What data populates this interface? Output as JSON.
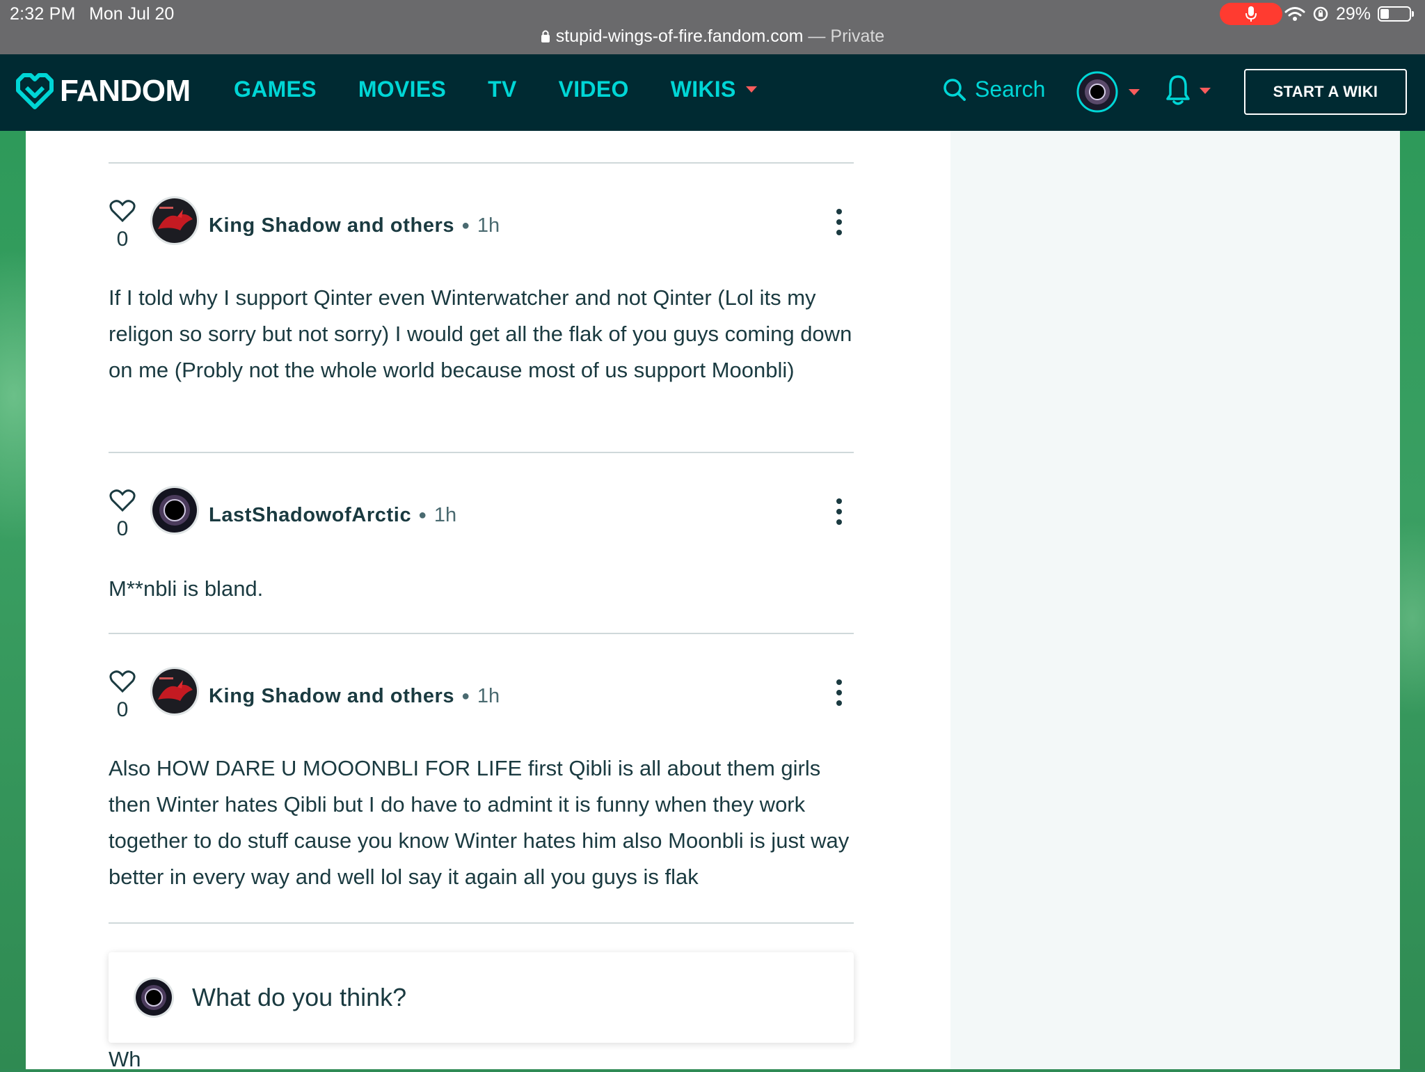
{
  "status_bar": {
    "time": "2:32 PM",
    "date": "Mon Jul 20",
    "battery": "29%",
    "battery_level": 0.29
  },
  "browser": {
    "url": "stupid-wings-of-fire.fandom.com",
    "separator": " — ",
    "mode": "Private"
  },
  "header": {
    "logo_text": "FANDOM",
    "nav": [
      "GAMES",
      "MOVIES",
      "TV",
      "VIDEO",
      "WIKIS"
    ],
    "search_label": "Search",
    "start_wiki": "START A WIKI"
  },
  "comments": [
    {
      "likes": "0",
      "author": "King Shadow and others",
      "time": "1h",
      "avatar": "red-dragon-avatar",
      "body": "If I told why I support Qinter even Winterwatcher and not Qinter (Lol its my religon so sorry but not sorry) I would get all the flak of you guys coming down on me (Probly not the whole world because most of us support Moonbli)"
    },
    {
      "likes": "0",
      "author": "LastShadowofArctic",
      "time": "1h",
      "avatar": "black-hole-avatar",
      "body": "M**nbli is bland."
    },
    {
      "likes": "0",
      "author": "King Shadow and others",
      "time": "1h",
      "avatar": "red-dragon-avatar",
      "body": "Also HOW DARE U MOOONBLI FOR LIFE first Qibli is all about them girls then Winter hates Qibli but I do have to admint it is funny when they work together to do stuff cause you know Winter hates him also Moonbli is just way better in every way and well lol say it again all you guys is flak"
    }
  ],
  "reply": {
    "placeholder": "What do you think?",
    "cutoff_text": "Wh"
  },
  "colors": {
    "nav_bg": "#002a32",
    "accent": "#00d6d6",
    "caret": "#fa5c5c",
    "mic": "#ff3b30"
  }
}
